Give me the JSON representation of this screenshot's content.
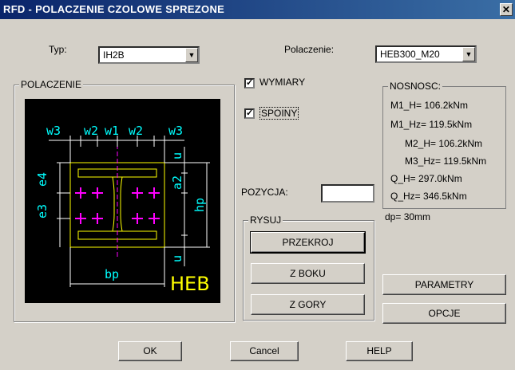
{
  "window": {
    "title": "RFD - POLACZENIE CZOLOWE SPREZONE",
    "close_glyph": "✕"
  },
  "typ": {
    "label": "Typ:",
    "value": "IH2B"
  },
  "polaczenie_sel": {
    "label": "Polaczenie:",
    "value": "HEB300_M20"
  },
  "group_polaczenie": {
    "title": "POLACZENIE"
  },
  "drawing": {
    "labels": {
      "w3a": "w3",
      "w2a": "w2",
      "w1": "w1",
      "w2b": "w2",
      "w3b": "w3",
      "e4": "e4",
      "e3": "e3",
      "u_top": "u",
      "a2": "a2",
      "hp": "hp",
      "bp": "bp",
      "u_bot": "u",
      "heb": "HEB"
    }
  },
  "checks": {
    "wymiary": {
      "label": "WYMIARY",
      "checked": true
    },
    "spoiny": {
      "label": "SPOINY",
      "checked": true
    }
  },
  "pozycja": {
    "label": "POZYCJA:",
    "value": ""
  },
  "rysuj": {
    "title": "RYSUJ",
    "buttons": [
      "PRZEKROJ",
      "Z BOKU",
      "Z GORY"
    ]
  },
  "nosnosc": {
    "title": "NOSNOSC:",
    "lines": [
      "M1_H=  106.2kNm",
      "M1_Hz= 119.5kNm",
      "M2_H=  106.2kNm",
      "M3_Hz= 119.5kNm",
      "Q_H=   297.0kNm",
      "Q_Hz=  346.5kNm"
    ]
  },
  "dp": "dp=  30mm",
  "side_buttons": {
    "parametry": "PARAMETRY",
    "opcje": "OPCJE"
  },
  "bottom_buttons": {
    "ok": "OK",
    "cancel": "Cancel",
    "help": "HELP"
  },
  "colors": {
    "title_bar": "#0a246a",
    "drawing_bg": "#000000",
    "dimension": "#00ffff",
    "plate": "#ffff00",
    "bolt": "#ff00ff",
    "face": "#d4d0c8"
  }
}
